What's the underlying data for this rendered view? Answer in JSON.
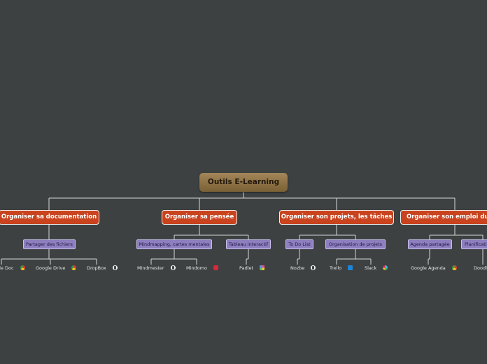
{
  "root": {
    "label": "Outils E-Learning"
  },
  "branches": [
    {
      "label": "Organiser sa documentation"
    },
    {
      "label": "Organiser sa pensée"
    },
    {
      "label": "Organiser son projets, les tâches"
    },
    {
      "label": "Organiser son emploi du temps"
    }
  ],
  "subtopics": [
    {
      "label": "Partager des fichiers"
    },
    {
      "label": "Mindmapping, cartes mentales"
    },
    {
      "label": "Tableau interactif"
    },
    {
      "label": "To Do List"
    },
    {
      "label": "Organisation de projets"
    },
    {
      "label": "Agenda partagée"
    },
    {
      "label": "Planification"
    }
  ],
  "leaves": [
    {
      "label": "Google Doc",
      "icon": "chrome-icon"
    },
    {
      "label": "Google Drive",
      "icon": "chrome-icon"
    },
    {
      "label": "DropBox",
      "icon": "globe-icon"
    },
    {
      "label": "Mindmester",
      "icon": "globe-icon"
    },
    {
      "label": "Mindomo",
      "icon": "mindomo-icon"
    },
    {
      "label": "Padlet",
      "icon": "padlet-icon"
    },
    {
      "label": "Nozbe",
      "icon": "globe-icon"
    },
    {
      "label": "Trello",
      "icon": "trello-icon"
    },
    {
      "label": "Slack",
      "icon": "slack-icon"
    },
    {
      "label": "Google Agenda",
      "icon": "chrome-icon"
    },
    {
      "label": "Doodle",
      "icon": ""
    }
  ],
  "colors": {
    "background": "#3d4142",
    "root": "#8f7246",
    "branch": "#c8431e",
    "subtopic": "#8e7fc0",
    "connector": "#d8d8d8"
  }
}
